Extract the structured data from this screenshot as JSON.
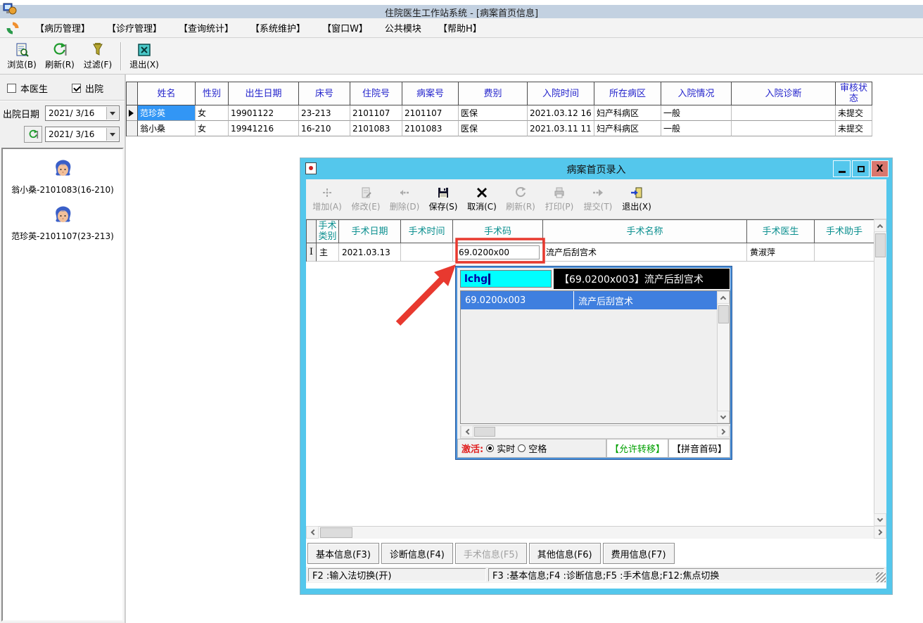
{
  "window": {
    "title": "住院医生工作站系统 - [病案首页信息]"
  },
  "menu": {
    "items": [
      "【病历管理】",
      "【诊疗管理】",
      "【查询统计】",
      "【系统维护】",
      "【窗口W】",
      "公共模块",
      "【帮助H】"
    ]
  },
  "main_toolbar": {
    "browse": "浏览(B)",
    "refresh": "刷新(R)",
    "filter": "过滤(F)",
    "exit": "退出(X)"
  },
  "filter_panel": {
    "my_doctor": "本医生",
    "discharged": "出院",
    "discharge_date_label": "出院日期",
    "date_from": "2021/ 3/16",
    "date_to": "2021/ 3/16"
  },
  "patients": [
    {
      "name": "翁小桑-2101083(16-210)"
    },
    {
      "name": "范珍英-2101107(23-213)"
    }
  ],
  "patient_table": {
    "headers": [
      "姓名",
      "性别",
      "出生日期",
      "床号",
      "住院号",
      "病案号",
      "费别",
      "入院时间",
      "所在病区",
      "入院情况",
      "入院诊断",
      "审核状态"
    ],
    "rows": [
      {
        "cells": [
          "范珍英",
          "女",
          "19901122",
          "23-213",
          "2101107",
          "2101107",
          "医保",
          "2021.03.12 16",
          "妇产科病区",
          "一般",
          "",
          "未提交"
        ]
      },
      {
        "cells": [
          "翁小桑",
          "女",
          "19941216",
          "16-210",
          "2101083",
          "2101083",
          "医保",
          "2021.03.11 11",
          "妇产科病区",
          "一般",
          "",
          "未提交"
        ]
      }
    ]
  },
  "dialog": {
    "title": "病案首页录入",
    "toolbar": {
      "add": "增加(A)",
      "edit": "修改(E)",
      "delete": "删除(D)",
      "save": "保存(S)",
      "cancel": "取消(C)",
      "refresh": "刷新(R)",
      "print": "打印(P)",
      "submit": "提交(T)",
      "exit": "退出(X)"
    },
    "surgery_table": {
      "headers": [
        "手术类别",
        "手术日期",
        "手术时间",
        "手术码",
        "手术名称",
        "手术医生",
        "手术助手"
      ],
      "row": {
        "marker": "I",
        "type": "主",
        "date": "2021.03.13",
        "time": "",
        "code": "69.0200x00",
        "name": "流产后刮宫术",
        "doctor": "黄淑萍",
        "assistant": ""
      }
    },
    "tabs": [
      {
        "label": "基本信息(F3)"
      },
      {
        "label": "诊断信息(F4)"
      },
      {
        "label": "手术信息(F5)"
      },
      {
        "label": "其他信息(F6)"
      },
      {
        "label": "费用信息(F7)"
      }
    ],
    "statusbar": {
      "left": "F2 :输入法切换(开)",
      "right": "F3 :基本信息;F4 :诊断信息;F5 :手术信息;F12:焦点切换"
    }
  },
  "popup": {
    "query": "lchg",
    "preview": "【69.0200x003】流产后刮宫术",
    "list": [
      {
        "code": "69.0200x003",
        "name": "流产后刮宫术"
      }
    ],
    "footer": {
      "activate_label": "激活:",
      "realtime": "实时",
      "space": "空格",
      "transfer": "【允许转移】",
      "pinyin": "【拼音首码】"
    }
  },
  "colors": {
    "dialog_accent": "#54c7ec",
    "selection_blue": "#3296f5",
    "list_selection": "#3f7fdf",
    "header_blue": "#2424cc",
    "header_teal": "#0a8f8f",
    "annotation_red": "#e8392f",
    "query_input_bg": "#00ffff"
  }
}
